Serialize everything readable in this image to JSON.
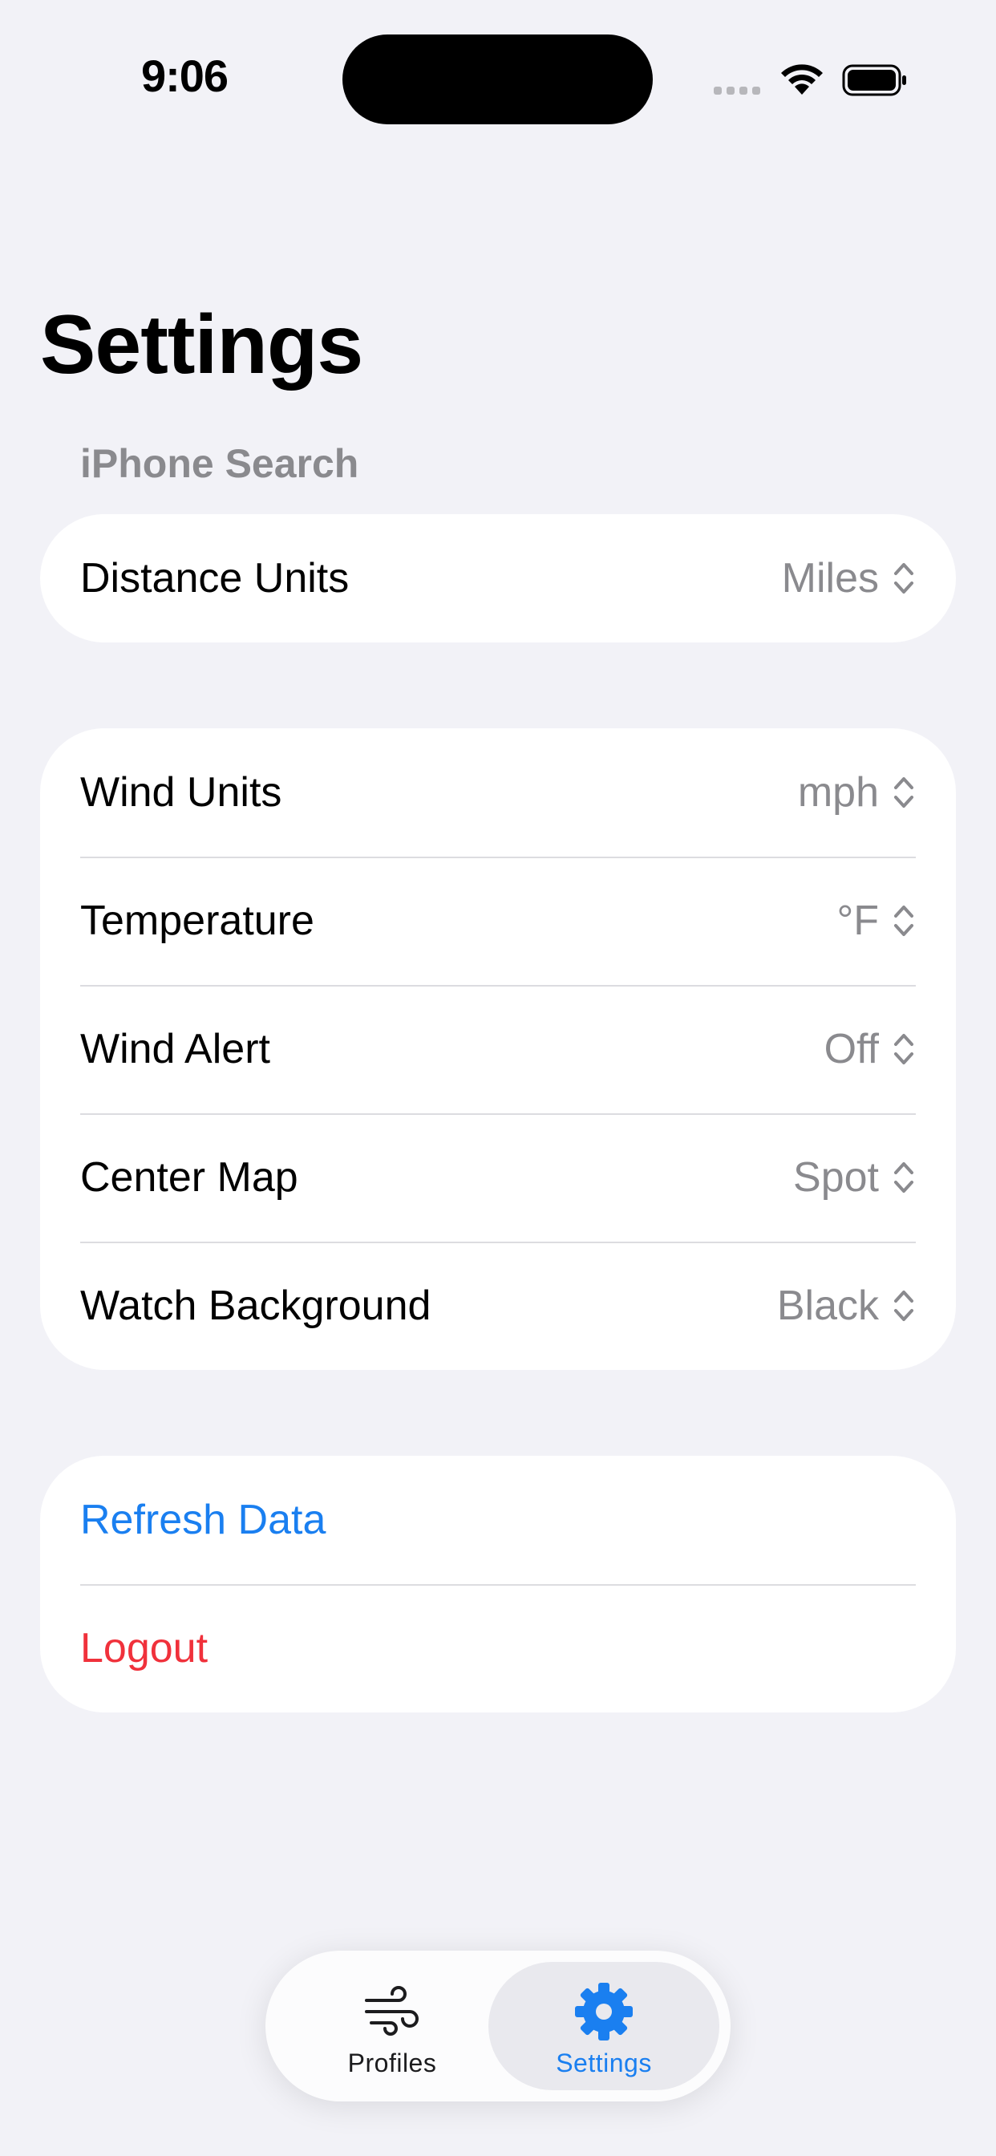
{
  "status_bar": {
    "time": "9:06"
  },
  "page": {
    "title": "Settings",
    "section_header": "iPhone Search"
  },
  "search_group": {
    "rows": [
      {
        "label": "Distance Units",
        "value": "Miles"
      }
    ]
  },
  "display_group": {
    "rows": [
      {
        "label": "Wind Units",
        "value": "mph"
      },
      {
        "label": "Temperature",
        "value": "°F"
      },
      {
        "label": "Wind Alert",
        "value": "Off"
      },
      {
        "label": "Center Map",
        "value": "Spot"
      },
      {
        "label": "Watch Background",
        "value": "Black"
      }
    ]
  },
  "actions_group": {
    "refresh": "Refresh Data",
    "logout": "Logout"
  },
  "tab_bar": {
    "profiles": {
      "label": "Profiles",
      "icon": "wind-icon"
    },
    "settings": {
      "label": "Settings",
      "icon": "gear-icon",
      "selected": true
    }
  },
  "colors": {
    "background": "#f2f2f7",
    "accent": "#1a7ff0",
    "destructive": "#f0313b",
    "secondary_text": "#8a8a8e"
  }
}
